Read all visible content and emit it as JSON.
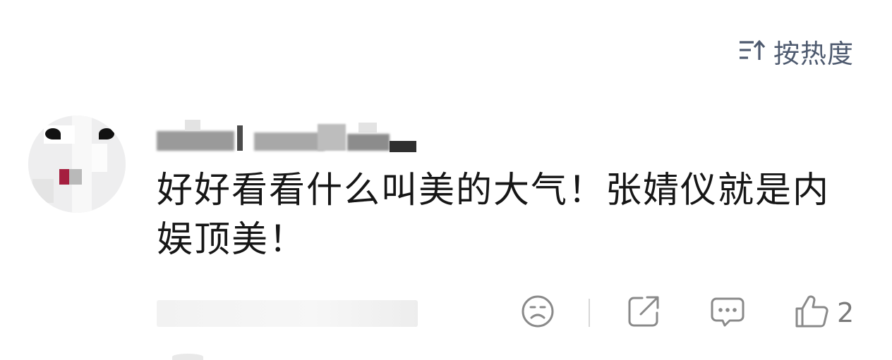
{
  "sort": {
    "label": "按热度",
    "icon": "sort-icon"
  },
  "comment": {
    "user": {
      "avatar_icon": "avatar"
    },
    "text": "好好看看什么叫美的大气！张婧仪就是内娱顶美！"
  },
  "actions": {
    "mood_icon": "sad-face-icon",
    "share_icon": "share-icon",
    "reply_icon": "comment-icon",
    "like_icon": "thumbs-up-icon",
    "like_count": "2"
  },
  "colors": {
    "text": "#161616",
    "icon": "#8a8a8a",
    "sort": "#4e5a6f"
  }
}
